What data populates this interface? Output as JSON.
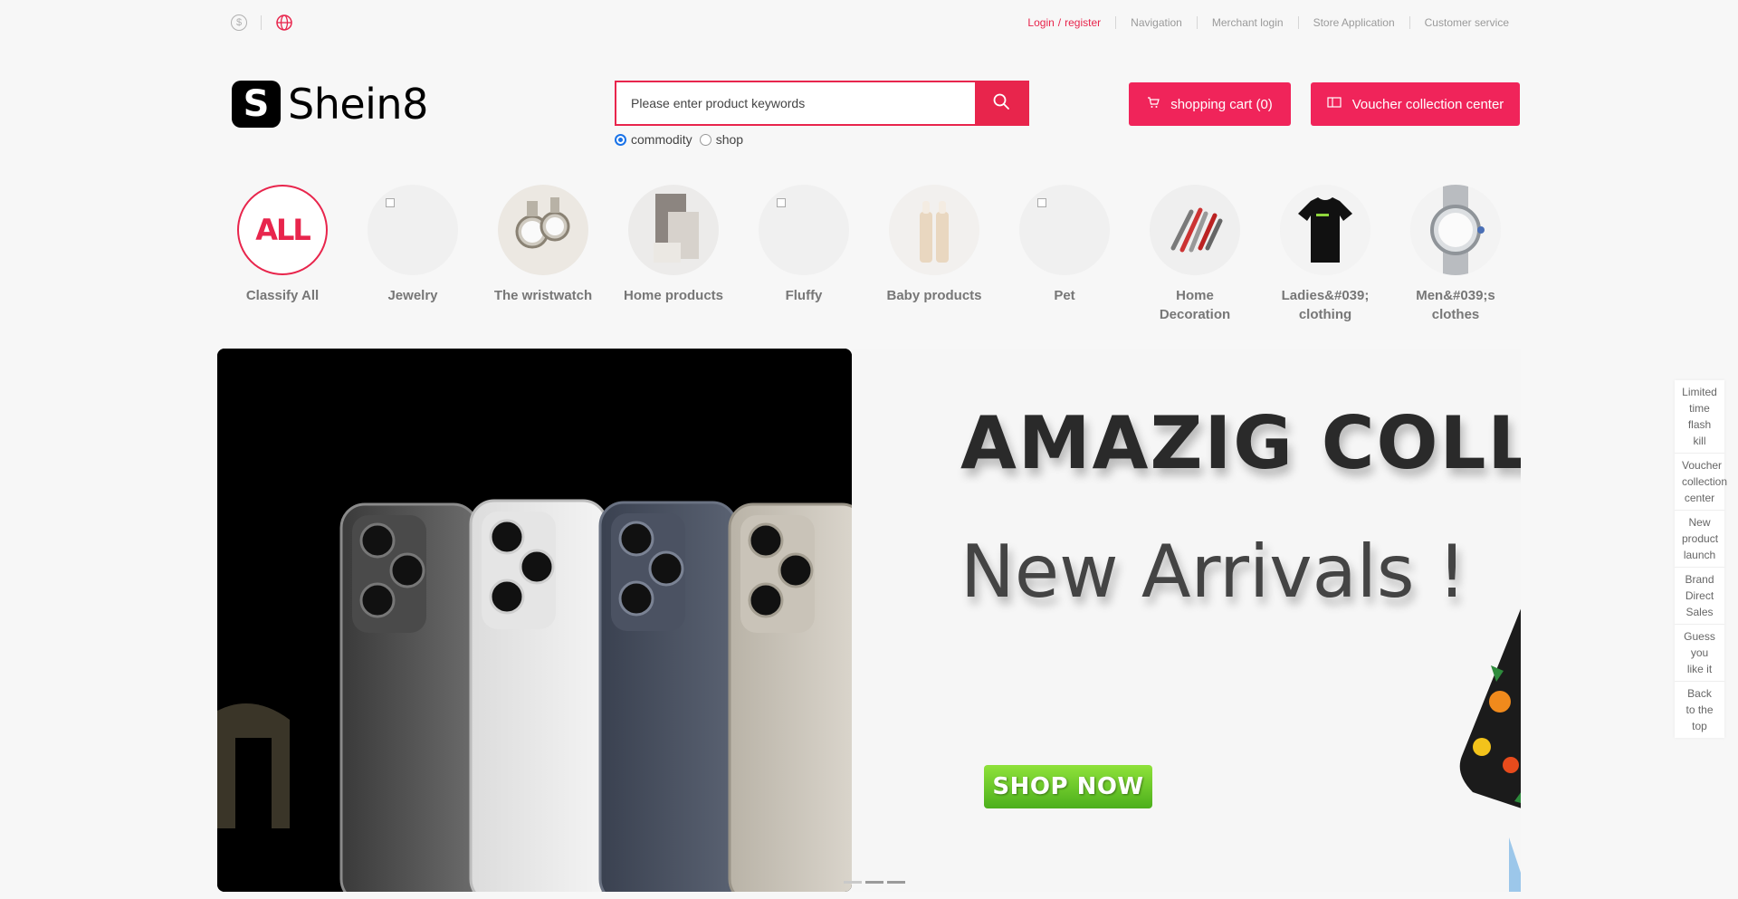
{
  "topbar": {
    "currency_icon": "dollar-icon",
    "language_icon": "globe-icon",
    "login": "Login",
    "slash": "/",
    "register": "register",
    "links": [
      "Navigation",
      "Merchant login",
      "Store Application",
      "Customer service"
    ]
  },
  "header": {
    "logo_mark": "S",
    "logo_text": "Shein8",
    "search_placeholder": "Please enter product keywords",
    "search_icon": "search-icon",
    "search_types": [
      {
        "label": "commodity",
        "checked": true
      },
      {
        "label": "shop",
        "checked": false
      }
    ],
    "cart_label": "shopping cart (0)",
    "voucher_label": "Voucher collection center"
  },
  "categories": [
    {
      "label": "Classify All",
      "badge": "ALL"
    },
    {
      "label": "Jewelry"
    },
    {
      "label": "The wristwatch"
    },
    {
      "label": "Home products"
    },
    {
      "label": "Fluffy"
    },
    {
      "label": "Baby products"
    },
    {
      "label": "Pet"
    },
    {
      "label": "Home Decoration"
    },
    {
      "label": "Ladies&#039; clothing"
    },
    {
      "label": "Men&#039;s clothes"
    }
  ],
  "banner": {
    "title": "AMAZIG COLLE",
    "subtitle": "New Arrivals !",
    "cta": "SHOP NOW"
  },
  "side_menu": [
    "Limited time flash kill",
    "Voucher collection center",
    "New product launch",
    "Brand Direct Sales",
    "Guess you like it",
    "Back to the top"
  ],
  "colors": {
    "accent": "#e8254c",
    "button": "#f0245a",
    "cta_green": "#6cc72a"
  }
}
